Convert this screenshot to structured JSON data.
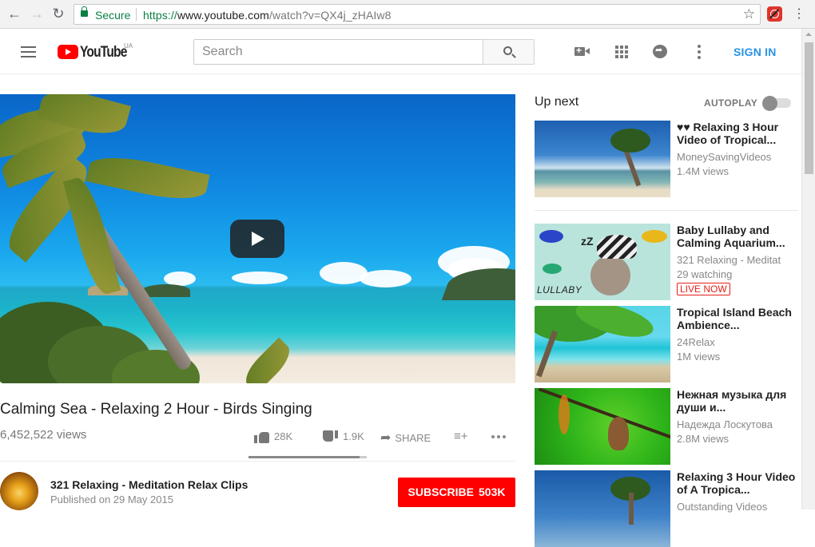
{
  "browser": {
    "back_icon": "arrow-left",
    "forward_icon": "arrow-right",
    "reload_icon": "reload",
    "security_label": "Secure",
    "url_scheme": "https://",
    "url_host": "www.youtube.com",
    "url_path": "/watch?v=QX4j_zHAIw8",
    "bookmark_icon": "star-outline",
    "extension_icon": "red-extension",
    "menu_icon": "vertical-dots"
  },
  "masthead": {
    "logo_text": "YouTube",
    "country_code": "UA",
    "search_placeholder": "Search",
    "search_value": "",
    "upload_icon": "video-camera-plus",
    "apps_icon": "grid",
    "messages_icon": "chat-bubble",
    "more_icon": "vertical-dots",
    "sign_in_label": "SIGN IN",
    "accent_color": "#2793e6",
    "brand_color": "#ff0000"
  },
  "video": {
    "title": "Calming Sea - Relaxing 2 Hour - Birds Singing",
    "views": "6,452,522 views",
    "likes": "28K",
    "dislikes": "1.9K",
    "share_label": "SHARE",
    "like_ratio": 0.94,
    "channel_name": "321 Relaxing - Meditation Relax Clips",
    "published": "Published on 29 May 2015",
    "subscribe_label": "SUBSCRIBE",
    "subscriber_count": "503K"
  },
  "sidebar": {
    "up_next_label": "Up next",
    "autoplay_label": "AUTOPLAY",
    "autoplay_on": false,
    "items": [
      {
        "title": "♥♥ Relaxing 3 Hour Video of Tropical...",
        "channel": "MoneySavingVideos",
        "meta": "1.4M views",
        "live": ""
      },
      {
        "title": "Baby Lullaby and Calming Aquarium...",
        "channel": "321 Relaxing - Meditat",
        "meta": "29 watching",
        "live": "LIVE NOW",
        "thumb_text": "LULLABY"
      },
      {
        "title": "Tropical Island Beach Ambience...",
        "channel": "24Relax",
        "meta": "1M views",
        "live": ""
      },
      {
        "title": "Нежная музыка для души и...",
        "channel": "Надежда Лоскутова",
        "meta": "2.8M views",
        "live": ""
      },
      {
        "title": "Relaxing 3 Hour Video of A Tropica...",
        "channel": "Outstanding Videos",
        "meta": "",
        "live": ""
      }
    ]
  }
}
